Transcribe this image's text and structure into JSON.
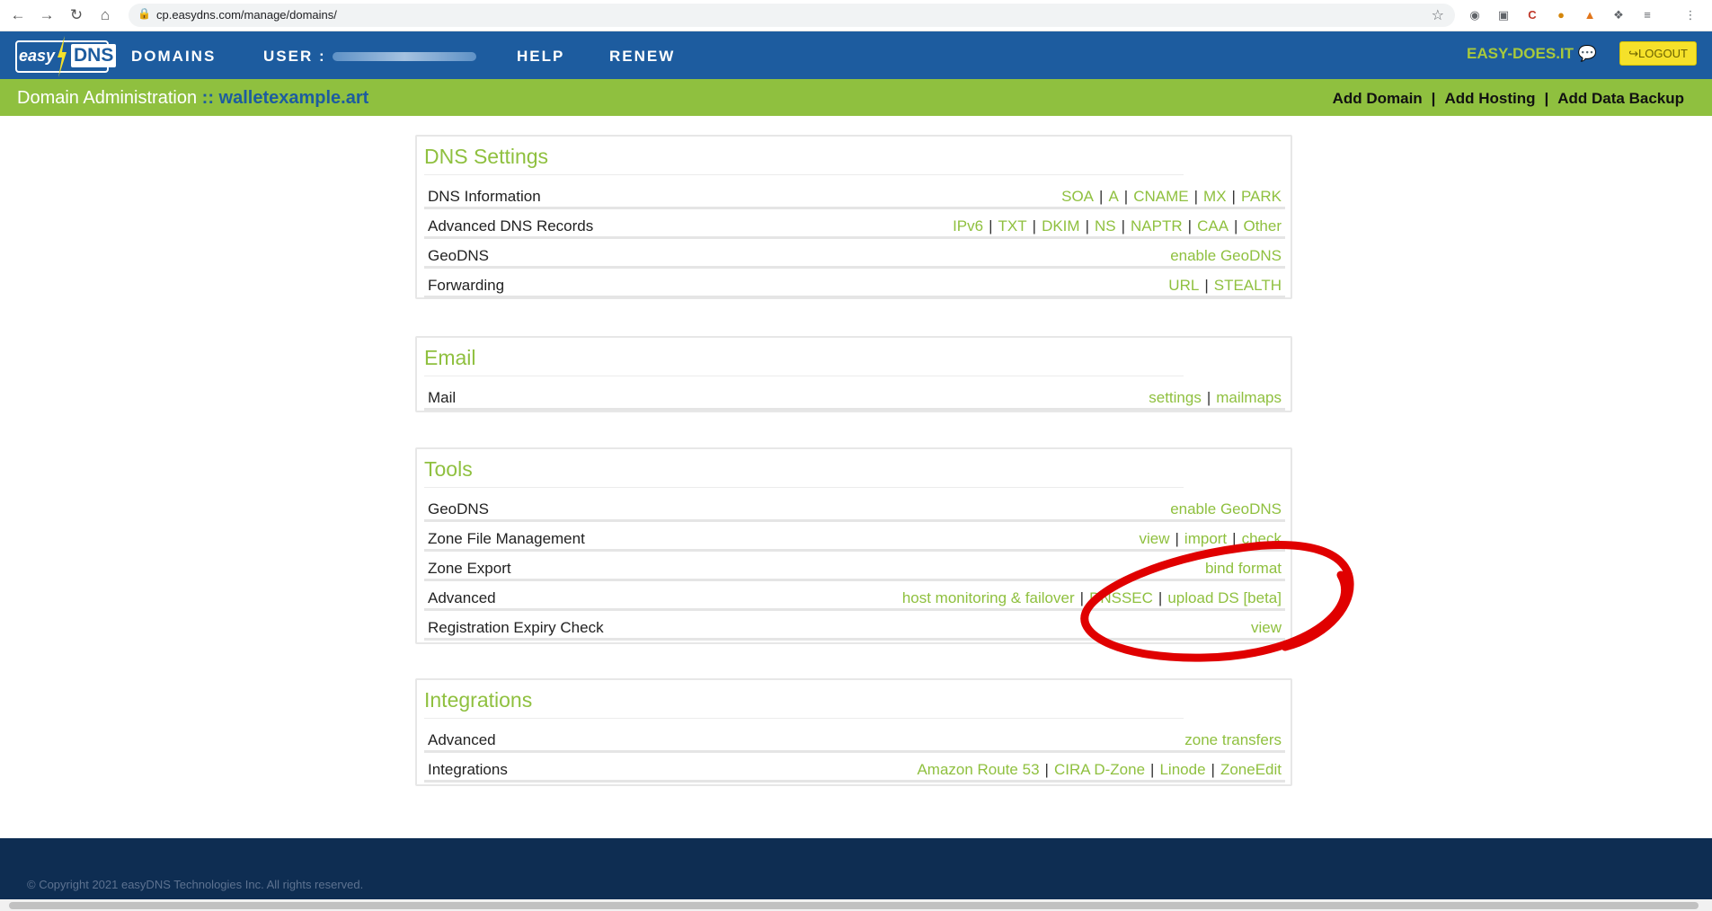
{
  "browser": {
    "url": "cp.easydns.com/manage/domains/"
  },
  "header": {
    "logo_easy": "easy",
    "logo_dns": "DNS",
    "menu": [
      "DOMAINS",
      "USER :",
      "HELP",
      "RENEW"
    ],
    "tagline": "EASY-DOES.IT",
    "logout": "LOGOUT"
  },
  "subheader": {
    "title": "Domain Administration",
    "separator": "::",
    "domain": "walletexample.art",
    "actions": [
      "Add Domain",
      "Add Hosting",
      "Add Data Backup"
    ]
  },
  "panels": [
    {
      "title": "DNS Settings",
      "rows": [
        {
          "label": "DNS Information",
          "links": [
            "SOA",
            "A",
            "CNAME",
            "MX",
            "PARK"
          ]
        },
        {
          "label": "Advanced DNS Records",
          "links": [
            "IPv6",
            "TXT",
            "DKIM",
            "NS",
            "NAPTR",
            "CAA",
            "Other"
          ]
        },
        {
          "label": "GeoDNS",
          "links": [
            "enable GeoDNS"
          ]
        },
        {
          "label": "Forwarding",
          "links": [
            "URL",
            "STEALTH"
          ]
        }
      ]
    },
    {
      "title": "Email",
      "rows": [
        {
          "label": "Mail",
          "links": [
            "settings",
            "mailmaps"
          ]
        }
      ]
    },
    {
      "title": "Tools",
      "rows": [
        {
          "label": "GeoDNS",
          "links": [
            "enable GeoDNS"
          ]
        },
        {
          "label": "Zone File Management",
          "links": [
            "view",
            "import",
            "check"
          ]
        },
        {
          "label": "Zone Export",
          "links": [
            "bind format"
          ]
        },
        {
          "label": "Advanced",
          "links": [
            "host monitoring & failover",
            "DNSSEC",
            "upload DS [beta]"
          ]
        },
        {
          "label": "Registration Expiry Check",
          "links": [
            "view"
          ]
        }
      ]
    },
    {
      "title": "Integrations",
      "rows": [
        {
          "label": "Advanced",
          "links": [
            "zone transfers"
          ]
        },
        {
          "label": "Integrations",
          "links": [
            "Amazon Route 53",
            "CIRA D-Zone",
            "Linode",
            "ZoneEdit"
          ]
        }
      ]
    }
  ],
  "footer": {
    "copyright": "© Copyright 2021 easyDNS Technologies Inc. All rights reserved."
  },
  "colors": {
    "brand_blue": "#1d5c9f",
    "brand_green": "#8fc03f",
    "annotation_red": "#e00000",
    "footer": "#0e2d52"
  }
}
